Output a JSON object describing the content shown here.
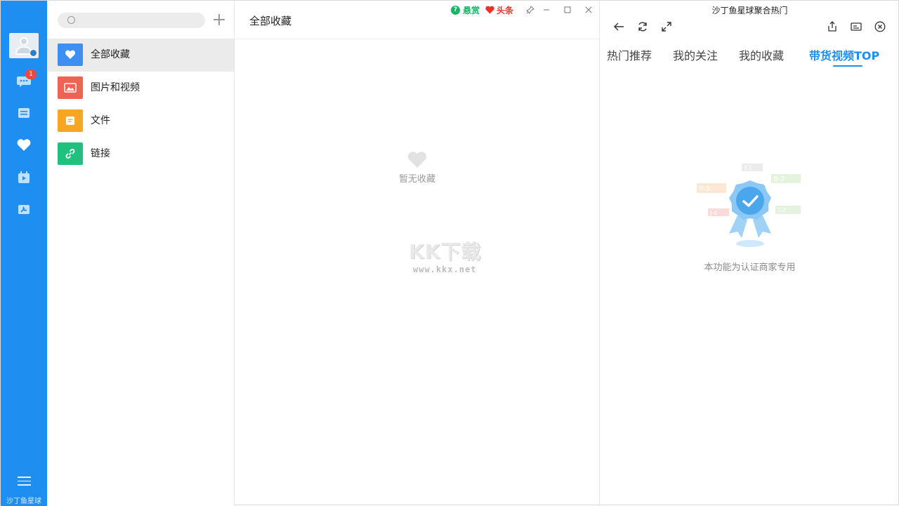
{
  "rail": {
    "message_badge": "1",
    "caption": "沙丁鱼星球"
  },
  "categories": {
    "search": {
      "placeholder": ""
    },
    "items": [
      {
        "label": "全部收藏",
        "color": "#3d8ff2",
        "icon": "heart-icon"
      },
      {
        "label": "图片和视频",
        "color": "#f06352",
        "icon": "image-icon"
      },
      {
        "label": "文件",
        "color": "#f7a623",
        "icon": "file-icon"
      },
      {
        "label": "链接",
        "color": "#22c07e",
        "icon": "link-icon"
      }
    ]
  },
  "main": {
    "title": "全部收藏",
    "top_links": {
      "reward": "悬赏",
      "news": "头条"
    },
    "empty_text": "暂无收藏",
    "watermark": {
      "main": "KK下载",
      "sub": "www.kkx.net"
    }
  },
  "right": {
    "title": "沙丁鱼星球聚合热门",
    "tabs": [
      {
        "label": "热门推荐"
      },
      {
        "label": "我的关注"
      },
      {
        "label": "我的收藏"
      },
      {
        "label": "带货视频TOP"
      }
    ],
    "active_tab": "带货视频TOP",
    "illustration_tags": [
      "T-1",
      "B-2",
      "P-3",
      "J-4",
      "T-2"
    ],
    "message": "本功能为认证商家专用"
  },
  "colors": {
    "accent": "#1e8ff0",
    "green": "#18b566",
    "red": "#e8322a"
  }
}
